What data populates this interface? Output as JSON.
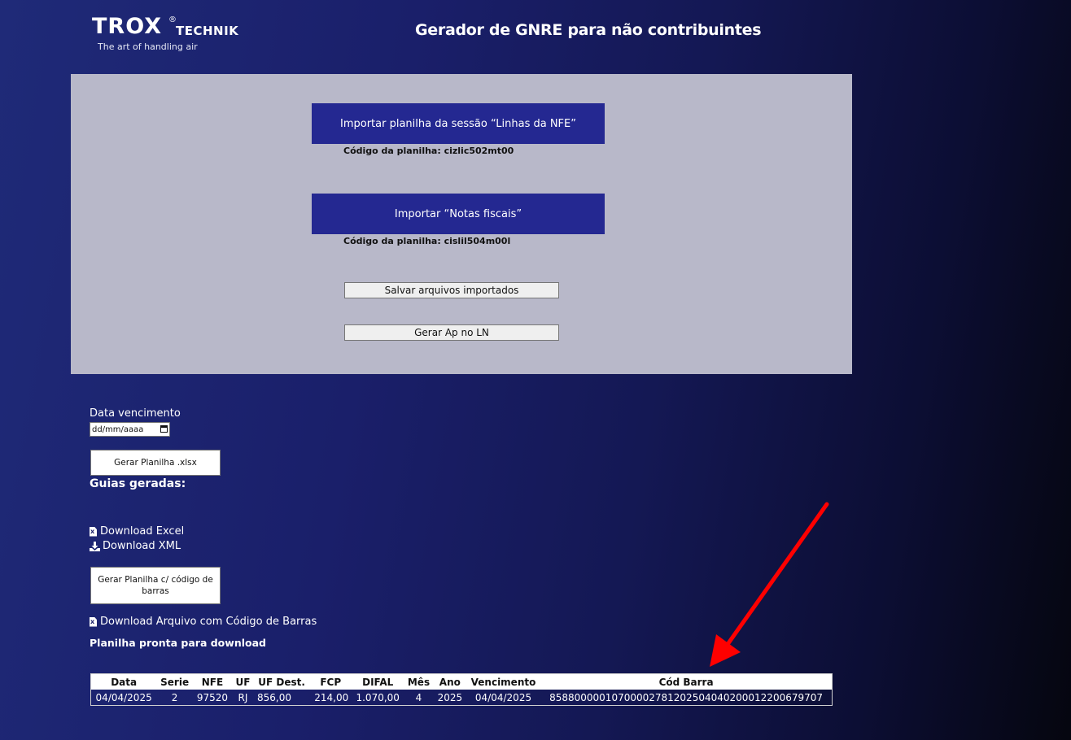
{
  "header": {
    "logo_word": "TROX",
    "logo_reg": "®",
    "logo_sub": "TECHNIK",
    "tagline": "The art of handling air",
    "title": "Gerador de GNRE para não contribuintes"
  },
  "import_panel": {
    "import_nfe_label": "Importar planilha da sessão “Linhas da NFE”",
    "import_nfe_code": "Código da planilha: cizlic502mt00",
    "import_notas_label": "Importar “Notas fiscais”",
    "import_notas_code": "Código da planilha: cislil504m00l",
    "save_label": "Salvar arquivos importados",
    "gerar_ap_label": "Gerar Ap no LN"
  },
  "generator": {
    "due_date_label": "Data vencimento",
    "due_date_placeholder": "dd/mm/aaaa",
    "gerar_planilha_label": "Gerar Planilha .xlsx",
    "guias_title": "Guias geradas:",
    "download_excel": "Download Excel",
    "download_xml": "Download XML",
    "gerar_barras_label": "Gerar Planilha c/ código de barras",
    "download_barras": "Download Arquivo com Código de Barras",
    "ready_label": "Planilha pronta para download"
  },
  "table": {
    "headers": [
      "Data",
      "Serie",
      "NFE",
      "UF",
      "UF Dest.",
      "FCP",
      "DIFAL",
      "Mês",
      "Ano",
      "Vencimento",
      "Cód Barra"
    ],
    "rows": [
      [
        "04/04/2025",
        "2",
        "97520",
        "RJ",
        "856,00",
        "214,00",
        "1.070,00",
        "4",
        "2025",
        "04/04/2025",
        "858800000107000027812025040402000122006797​07"
      ]
    ]
  },
  "colors": {
    "accent": "#242891",
    "panel": "#b8b8c9",
    "arrow": "#ff0000"
  }
}
